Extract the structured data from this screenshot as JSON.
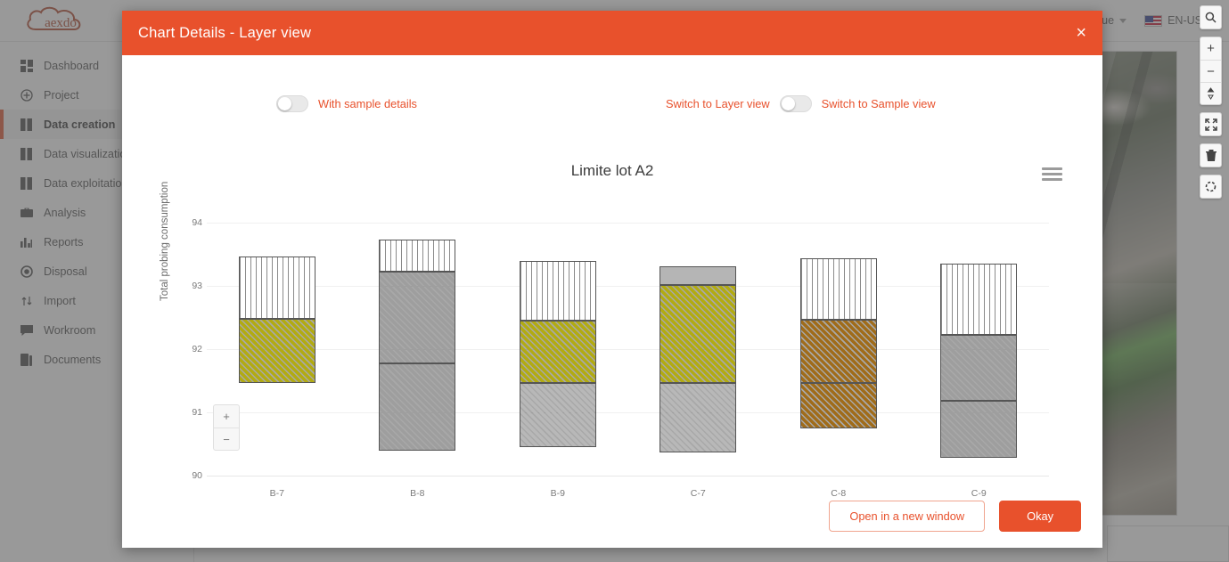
{
  "header": {
    "logo_text": "aexdo",
    "buttons": [
      {
        "label": ""
      },
      {
        "label": ""
      }
    ],
    "account_label": "ique",
    "language_label": "EN-US"
  },
  "sidebar": {
    "items": [
      {
        "label": "Dashboard",
        "icon": "dashboard-icon",
        "active": false
      },
      {
        "label": "Project",
        "icon": "plus-circle-icon",
        "active": false
      },
      {
        "label": "Data creation",
        "icon": "book-icon",
        "active": true
      },
      {
        "label": "Data visualization",
        "icon": "book-icon",
        "active": false
      },
      {
        "label": "Data exploitation",
        "icon": "book-icon",
        "active": false
      },
      {
        "label": "Analysis",
        "icon": "briefcase-icon",
        "active": false
      },
      {
        "label": "Reports",
        "icon": "bar-chart-icon",
        "active": false
      },
      {
        "label": "Disposal",
        "icon": "target-icon",
        "active": false
      },
      {
        "label": "Import",
        "icon": "import-arrows-icon",
        "active": false
      },
      {
        "label": "Workroom",
        "icon": "chat-icon",
        "active": false
      },
      {
        "label": "Documents",
        "icon": "documents-icon",
        "active": false
      }
    ]
  },
  "map_controls": [
    {
      "icon": "search-icon",
      "label": ""
    },
    {
      "icon": "zoom-in-icon",
      "label": "+"
    },
    {
      "icon": "zoom-out-icon",
      "label": "−"
    },
    {
      "icon": "compass-icon",
      "label": ""
    },
    {
      "icon": "fullscreen-icon",
      "label": ""
    },
    {
      "icon": "trash-icon",
      "label": ""
    },
    {
      "icon": "refresh-icon",
      "label": ""
    }
  ],
  "modal": {
    "title": "Chart Details - Layer view",
    "close_label": "×",
    "toggle_sample_details": "With sample details",
    "toggle_layer_view": "Switch to Layer view",
    "toggle_sample_view": "Switch to Sample view",
    "menu_icon": "hamburger-menu-icon",
    "zoom_in": "+",
    "zoom_out": "−",
    "open_new_window": "Open in a new window",
    "okay": "Okay",
    "accent_color": "#e8512c"
  },
  "chart_data": {
    "type": "bar",
    "stacked": true,
    "title": "Limite lot A2",
    "xlabel": "",
    "ylabel": "Total probing consumption",
    "ylim": [
      90,
      94
    ],
    "yticks": [
      90,
      91,
      92,
      93,
      94
    ],
    "grid": true,
    "legend_position": "none",
    "categories": [
      "B-7",
      "B-8",
      "B-9",
      "C-7",
      "C-8",
      "C-9"
    ],
    "bars": [
      {
        "category": "B-7",
        "top": 93.47,
        "bottom": 91.47,
        "segments": [
          {
            "from": 92.48,
            "to": 93.47,
            "fill": "#ffffff",
            "pattern": "vertical-lines",
            "color_hex": "#ffffff"
          },
          {
            "from": 91.47,
            "to": 92.48,
            "fill": "#b2ab12",
            "pattern": "diagonal-hatch",
            "color_hex": "#b2ab12"
          }
        ]
      },
      {
        "category": "B-8",
        "top": 93.73,
        "bottom": 90.4,
        "segments": [
          {
            "from": 93.22,
            "to": 93.73,
            "fill": "#ffffff",
            "pattern": "vertical-lines",
            "color_hex": "#ffffff"
          },
          {
            "from": 91.77,
            "to": 93.22,
            "fill": "#9e9e9e",
            "pattern": "diagonal-hatch",
            "color_hex": "#9e9e9e"
          },
          {
            "from": 90.4,
            "to": 91.77,
            "fill": "#9e9e9e",
            "pattern": "diagonal-hatch",
            "color_hex": "#9e9e9e"
          }
        ]
      },
      {
        "category": "B-9",
        "top": 93.4,
        "bottom": 90.45,
        "segments": [
          {
            "from": 92.45,
            "to": 93.4,
            "fill": "#ffffff",
            "pattern": "vertical-lines",
            "color_hex": "#ffffff"
          },
          {
            "from": 91.47,
            "to": 92.45,
            "fill": "#b2ab12",
            "pattern": "diagonal-hatch",
            "color_hex": "#b2ab12"
          },
          {
            "from": 90.45,
            "to": 91.47,
            "fill": "#b8b8b8",
            "pattern": "diagonal-hatch",
            "color_hex": "#b8b8b8"
          }
        ]
      },
      {
        "category": "C-7",
        "top": 93.31,
        "bottom": 90.37,
        "segments": [
          {
            "from": 93.02,
            "to": 93.31,
            "fill": "#b5b5b5",
            "pattern": "solid",
            "color_hex": "#b5b5b5"
          },
          {
            "from": 91.47,
            "to": 93.02,
            "fill": "#b2ab12",
            "pattern": "diagonal-hatch",
            "color_hex": "#b2ab12"
          },
          {
            "from": 90.37,
            "to": 91.47,
            "fill": "#b8b8b8",
            "pattern": "diagonal-hatch",
            "color_hex": "#b8b8b8"
          }
        ]
      },
      {
        "category": "C-8",
        "top": 93.43,
        "bottom": 90.74,
        "segments": [
          {
            "from": 92.46,
            "to": 93.43,
            "fill": "#ffffff",
            "pattern": "vertical-lines",
            "color_hex": "#ffffff"
          },
          {
            "from": 91.47,
            "to": 92.46,
            "fill": "#a06c1a",
            "pattern": "diagonal-hatch",
            "color_hex": "#a06c1a"
          },
          {
            "from": 90.74,
            "to": 91.47,
            "fill": "#a06c1a",
            "pattern": "diagonal-hatch",
            "color_hex": "#a06c1a"
          }
        ]
      },
      {
        "category": "C-9",
        "top": 93.35,
        "bottom": 90.28,
        "segments": [
          {
            "from": 92.23,
            "to": 93.35,
            "fill": "#ffffff",
            "pattern": "vertical-lines",
            "color_hex": "#ffffff"
          },
          {
            "from": 91.18,
            "to": 92.23,
            "fill": "#9e9e9e",
            "pattern": "diagonal-hatch",
            "color_hex": "#9e9e9e"
          },
          {
            "from": 90.28,
            "to": 91.18,
            "fill": "#9e9e9e",
            "pattern": "diagonal-hatch",
            "color_hex": "#9e9e9e"
          }
        ]
      }
    ]
  }
}
